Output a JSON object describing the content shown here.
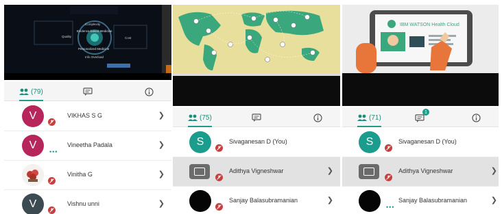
{
  "colors": {
    "accent": "#1c9c8c",
    "mute_badge": "#c74040",
    "avatar_v": "#b7265b",
    "avatar_s": "#1c9c8c",
    "avatar_vishnu": "#3c4a52"
  },
  "panels": [
    {
      "slide": {
        "lines": [
          "Complexity",
          "Evidence-based Medicine",
          "Personalized Medicine",
          "Info Overload",
          "Cost",
          "Quality"
        ]
      },
      "tabs": {
        "people_count": "(79)",
        "people_icon": "people-icon",
        "chat_icon": "chat-icon",
        "info_icon": "info-icon"
      },
      "participants": [
        {
          "initial": "V",
          "name": "VIKHAS S G"
        },
        {
          "initial": "V",
          "name": "Vineetha Padala"
        },
        {
          "initial": "",
          "name": "Vinitha G"
        },
        {
          "initial": "V",
          "name": "Vishnu unni"
        }
      ]
    },
    {
      "slide": {
        "lines": []
      },
      "tabs": {
        "people_count": "(75)",
        "people_icon": "people-icon",
        "chat_icon": "chat-icon",
        "info_icon": "info-icon"
      },
      "participants": [
        {
          "initial": "S",
          "name": "Sivaganesan D (You)"
        },
        {
          "initial": "",
          "name": "Adithya Vigneshwar"
        },
        {
          "initial": "",
          "name": "Sanjay Balasubramanian"
        }
      ]
    },
    {
      "slide": {
        "title": "IBM WATSON Health Cloud"
      },
      "tabs": {
        "people_count": "(71)",
        "chat_badge": "1",
        "people_icon": "people-icon",
        "chat_icon": "chat-icon",
        "info_icon": "info-icon"
      },
      "participants": [
        {
          "initial": "S",
          "name": "Sivaganesan D (You)"
        },
        {
          "initial": "",
          "name": "Adithya Vigneshwar"
        },
        {
          "initial": "",
          "name": "Sanjay Balasubramanian"
        }
      ]
    }
  ]
}
